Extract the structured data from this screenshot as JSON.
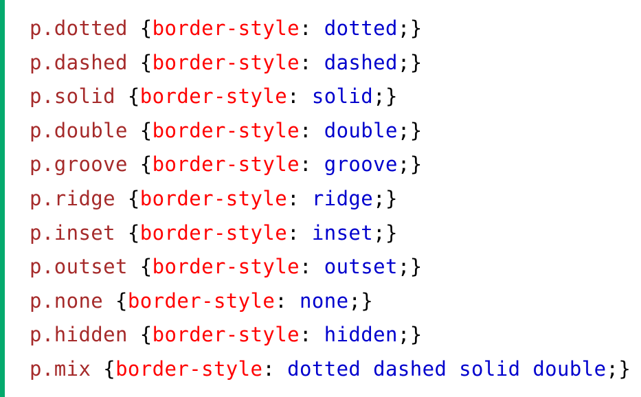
{
  "colors": {
    "accent_border": "#04AA6D",
    "selector": "#a52a2a",
    "property": "#ff0000",
    "value": "#0000cd",
    "punctuation": "#000000",
    "background": "#ffffff"
  },
  "code": {
    "lines": [
      {
        "selector": "p.dotted",
        "property": "border-style",
        "value": "dotted"
      },
      {
        "selector": "p.dashed",
        "property": "border-style",
        "value": "dashed"
      },
      {
        "selector": "p.solid",
        "property": "border-style",
        "value": "solid"
      },
      {
        "selector": "p.double",
        "property": "border-style",
        "value": "double"
      },
      {
        "selector": "p.groove",
        "property": "border-style",
        "value": "groove"
      },
      {
        "selector": "p.ridge",
        "property": "border-style",
        "value": "ridge"
      },
      {
        "selector": "p.inset",
        "property": "border-style",
        "value": "inset"
      },
      {
        "selector": "p.outset",
        "property": "border-style",
        "value": "outset"
      },
      {
        "selector": "p.none",
        "property": "border-style",
        "value": "none"
      },
      {
        "selector": "p.hidden",
        "property": "border-style",
        "value": "hidden"
      },
      {
        "selector": "p.mix",
        "property": "border-style",
        "value": "dotted dashed solid double"
      }
    ]
  }
}
